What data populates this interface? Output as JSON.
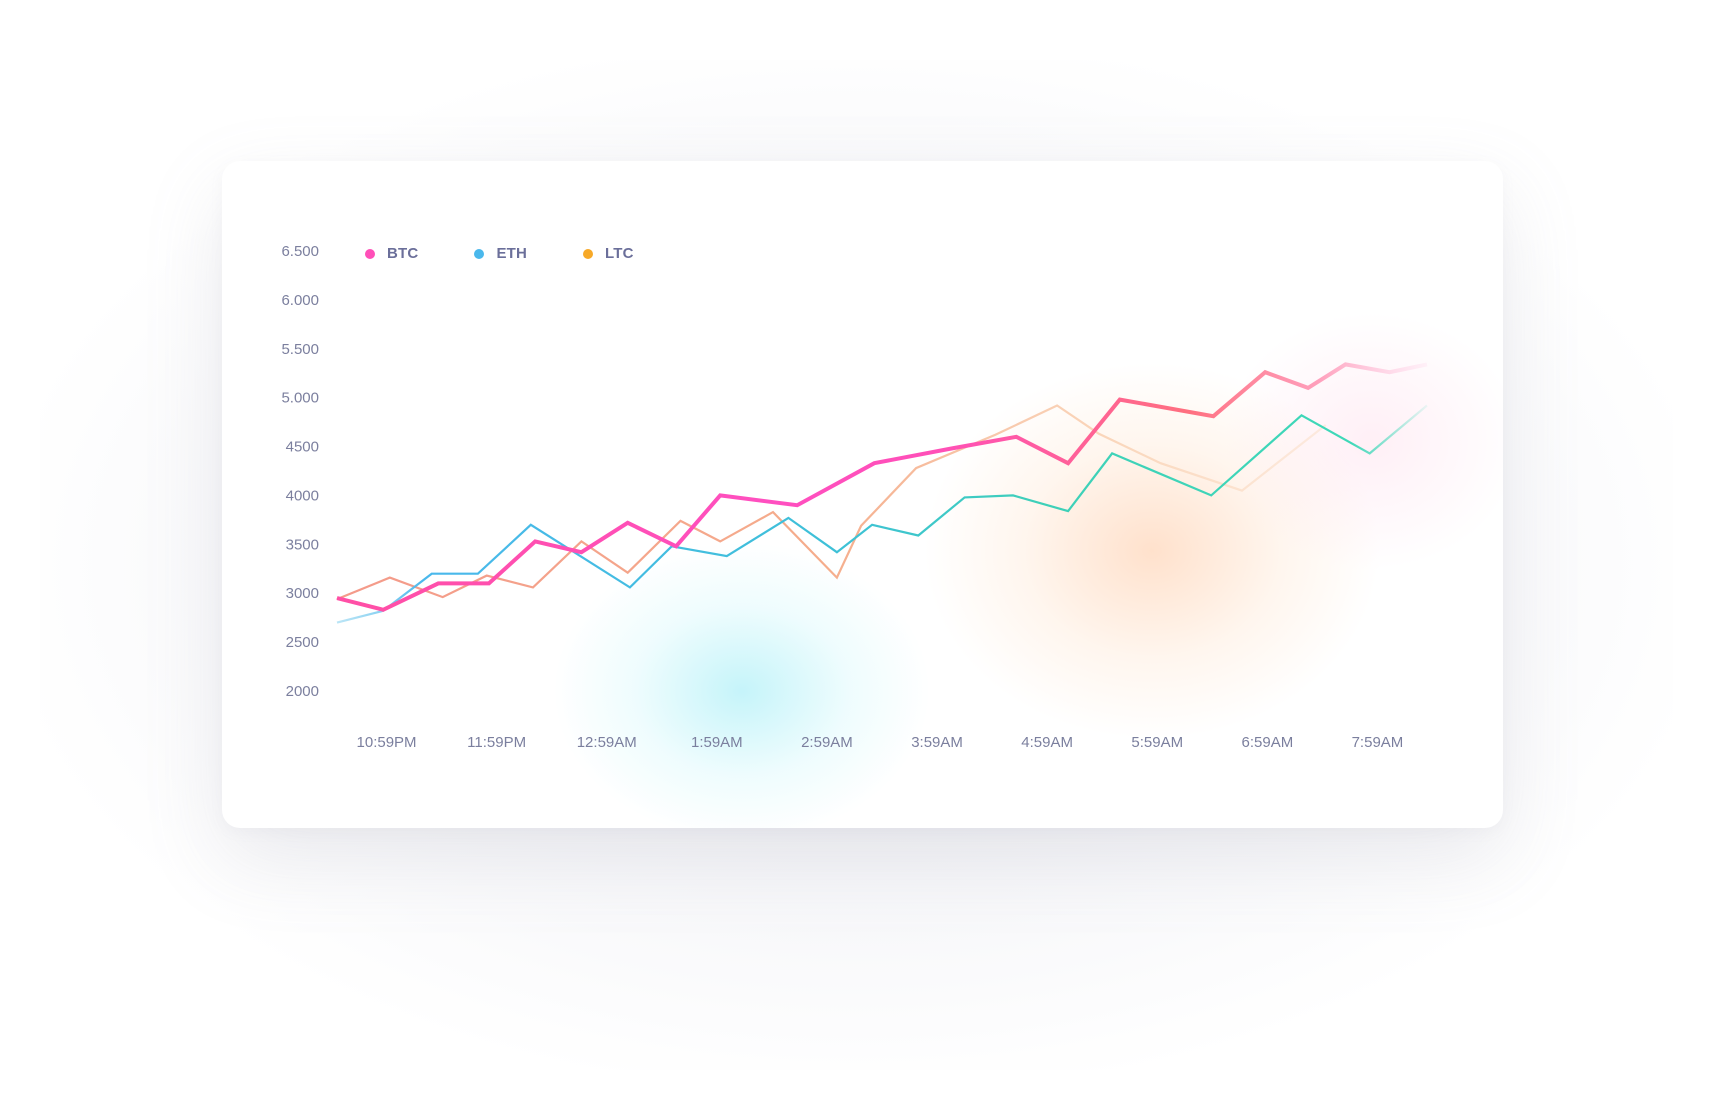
{
  "colors": {
    "btc": "#ff4fb8",
    "eth": "#4ab8ec",
    "ltc": "#f7a928",
    "axis_text": "#7b7f9e",
    "legend_text": "#6b6f9a"
  },
  "chart_data": {
    "type": "line",
    "x_ticks": [
      "10:59PM",
      "11:59PM",
      "12:59AM",
      "1:59AM",
      "2:59AM",
      "3:59AM",
      "4:59AM",
      "5:59AM",
      "6:59AM",
      "7:59AM"
    ],
    "y_ticks": [
      "6.500",
      "6.000",
      "5.500",
      "5.000",
      "4500",
      "4000",
      "3500",
      "3000",
      "2500",
      "2000"
    ],
    "ylim": [
      2000,
      6500
    ],
    "xlim": [
      -0.45,
      9.45
    ],
    "grid": false,
    "legend_position": "top-left",
    "legend": [
      {
        "name": "BTC",
        "color": "#ff4fb8"
      },
      {
        "name": "ETH",
        "color": "#4ab8ec"
      },
      {
        "name": "LTC",
        "color": "#f7a928"
      }
    ],
    "series": [
      {
        "name": "BTC",
        "x": [
          -0.45,
          -0.03,
          0.47,
          0.93,
          1.35,
          1.77,
          2.19,
          2.63,
          3.03,
          3.73,
          4.43,
          5.13,
          5.72,
          6.19,
          6.66,
          7.51,
          7.98,
          8.37,
          8.71,
          9.11,
          9.45
        ],
        "y": [
          2950,
          2830,
          3100,
          3100,
          3530,
          3420,
          3720,
          3480,
          4000,
          3900,
          4330,
          4480,
          4600,
          4330,
          4980,
          4810,
          5260,
          5100,
          5340,
          5260,
          5340
        ]
      },
      {
        "name": "ETH",
        "x": [
          -0.45,
          -0.03,
          0.41,
          0.83,
          1.31,
          2.21,
          2.59,
          3.09,
          3.65,
          4.09,
          4.41,
          4.83,
          5.25,
          5.69,
          6.19,
          6.59,
          7.49,
          8.31,
          8.93,
          9.45
        ],
        "y": [
          2700,
          2820,
          3200,
          3200,
          3700,
          3060,
          3480,
          3380,
          3770,
          3420,
          3700,
          3590,
          3980,
          4000,
          3840,
          4430,
          4000,
          4820,
          4430,
          4920
        ]
      },
      {
        "name": "LTC",
        "x": [
          -0.45,
          0.03,
          0.51,
          0.91,
          1.33,
          1.77,
          2.19,
          2.67,
          3.03,
          3.51,
          4.09,
          4.31,
          4.81,
          5.53,
          6.09,
          6.47,
          7.03,
          7.77,
          8.53
        ],
        "y": [
          2940,
          3160,
          2960,
          3180,
          3060,
          3530,
          3210,
          3740,
          3530,
          3830,
          3160,
          3690,
          4280,
          4620,
          4920,
          4630,
          4330,
          4050,
          4720
        ]
      }
    ]
  }
}
